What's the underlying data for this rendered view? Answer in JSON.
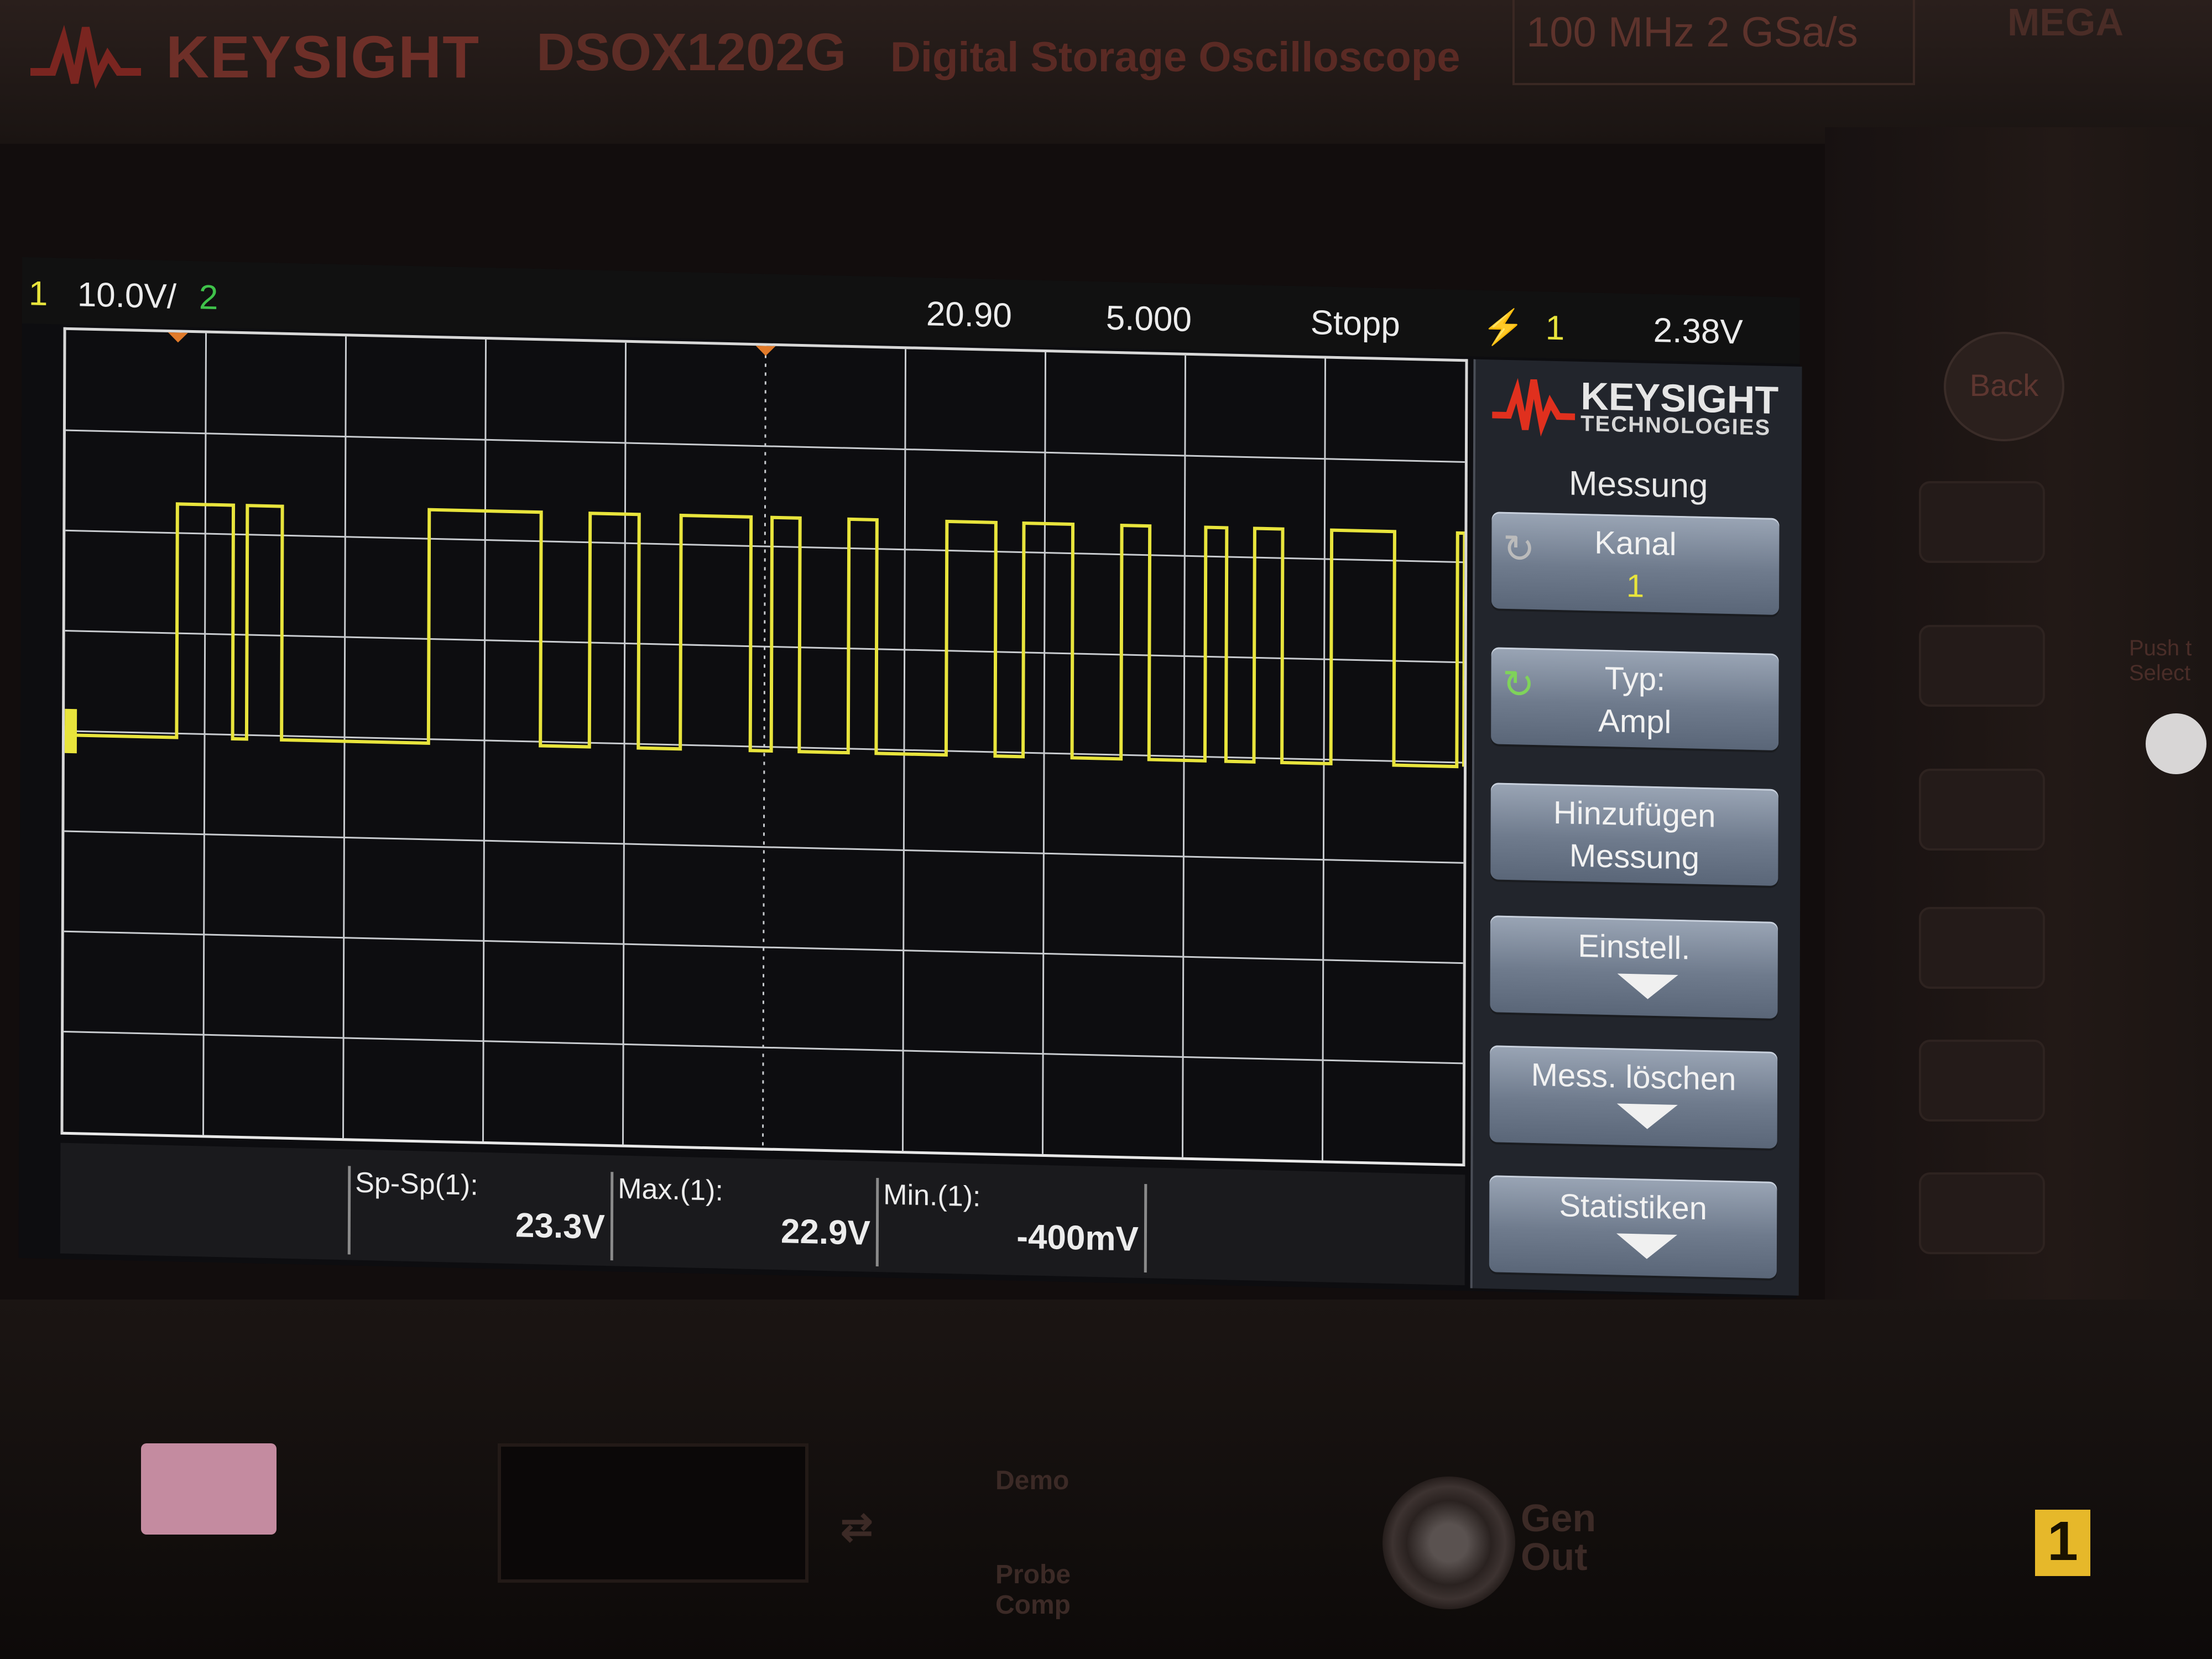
{
  "bezel": {
    "brand": "KEYSIGHT",
    "model": "DSOX1202G",
    "description": "Digital Storage Oscilloscope",
    "spec": "100 MHz  2 GSa/s",
    "badge": "MEGA"
  },
  "status_bar": {
    "channel1_label": "1",
    "channel1_scale": "10.0V/",
    "channel2_label": "2",
    "time_offset": "20.90",
    "time_scale": "5.000",
    "run_state": "Stopp",
    "trigger_channel": "1",
    "trigger_level": "2.38V"
  },
  "measurements": [
    {
      "label": "Sp-Sp(1):",
      "value": "23.3V"
    },
    {
      "label": "Max.(1):",
      "value": "22.9V"
    },
    {
      "label": "Min.(1):",
      "value": "-400mV"
    }
  ],
  "softkey_panel": {
    "logo_line1": "KEYSIGHT",
    "logo_line2": "TECHNOLOGIES",
    "title": "Messung",
    "keys": [
      {
        "line1": "Kanal",
        "line2": "1"
      },
      {
        "line1": "Typ:",
        "line2": "Ampl"
      },
      {
        "line1": "Hinzufügen",
        "line2": "Messung"
      },
      {
        "line1": "Einstell.",
        "line2": ""
      },
      {
        "line1": "Mess. löschen",
        "line2": ""
      },
      {
        "line1": "Statistiken",
        "line2": ""
      }
    ]
  },
  "hardware": {
    "back_label": "Back",
    "push_select": "Push t Select",
    "demo_label": "Demo",
    "probe_comp_label": "Probe Comp",
    "gen_out_label": "Gen Out",
    "channel_tag": "1"
  },
  "colors": {
    "trace": "#e8e43c",
    "grid": "#c9ccd0",
    "screen_bg": "#0d0d10",
    "softkey": "#7a8698"
  },
  "waveform": {
    "channel": "1",
    "low_volts": -0.4,
    "high_volts": 22.9,
    "pulses_divisions": [
      [
        0.8,
        1.2
      ],
      [
        1.3,
        1.55
      ],
      [
        2.6,
        3.4
      ],
      [
        3.75,
        4.1
      ],
      [
        4.4,
        4.9
      ],
      [
        5.05,
        5.25
      ],
      [
        5.6,
        5.8
      ],
      [
        6.3,
        6.65
      ],
      [
        6.85,
        7.2
      ],
      [
        7.55,
        7.75
      ],
      [
        8.15,
        8.3
      ],
      [
        8.5,
        8.7
      ],
      [
        9.05,
        9.5
      ],
      [
        9.95,
        10.0
      ]
    ]
  }
}
